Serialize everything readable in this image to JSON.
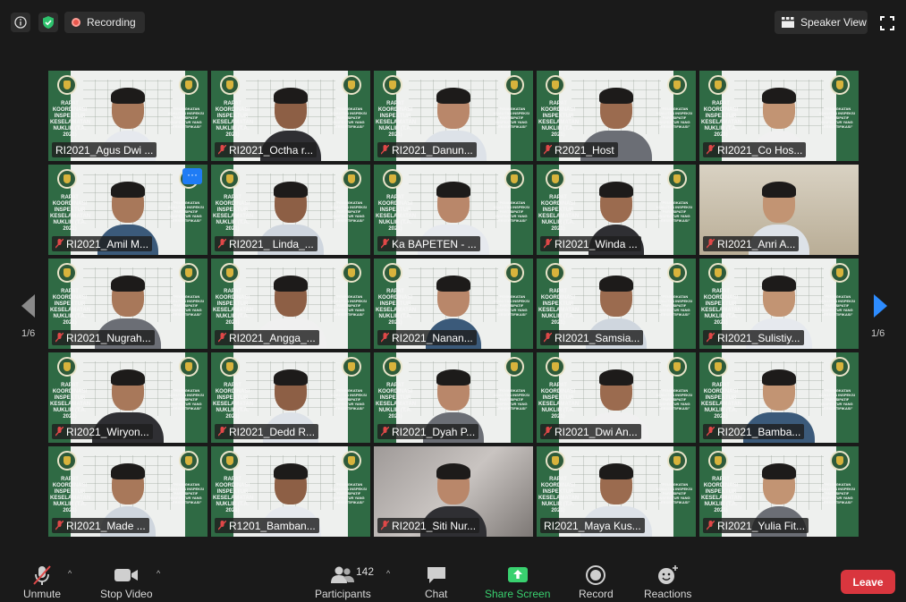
{
  "topbar": {
    "recording_label": "Recording",
    "view_label": "Speaker View",
    "icons": [
      "info-icon",
      "shield-icon",
      "recording-icon",
      "speaker-view-icon",
      "fullscreen-icon"
    ],
    "shield_color": "#2ec26d"
  },
  "pagination": {
    "left_page": "1/6",
    "right_page": "1/6",
    "arrow_right_color": "#2d8cff"
  },
  "slide": {
    "left_text": "RAPAT KOORDINASI INSPEKTUR KESELAMATAN NUKLIR (T.A. 2021)",
    "right_text": "\"PENINGKATAN KUALITAS INSPEKSI PARTISIPATIF INSPEKTUR YANG TERSERTIFIKASI\""
  },
  "participants": [
    {
      "name": "RI2021_Agus Dwi ...",
      "active": true,
      "muted": false
    },
    {
      "name": "RI2021_Octha r...",
      "muted": true
    },
    {
      "name": "RI2021_Danun...",
      "muted": true
    },
    {
      "name": "R2021_Host",
      "muted": true
    },
    {
      "name": "RI2021_Co Hos...",
      "muted": true
    },
    {
      "name": "RI2021_Amil M...",
      "muted": true,
      "menu": "···"
    },
    {
      "name": "RI2021_ Linda_...",
      "muted": true
    },
    {
      "name": "Ka BAPETEN - ...",
      "muted": true
    },
    {
      "name": "RI2021_Winda ...",
      "muted": true
    },
    {
      "name": "RI2021_Anri A...",
      "muted": true
    },
    {
      "name": "RI2021_Nugrah...",
      "muted": true
    },
    {
      "name": "RI2021_Angga_...",
      "muted": true
    },
    {
      "name": "RI2021_Nanan...",
      "muted": true
    },
    {
      "name": "RI2021_Samsia...",
      "muted": true
    },
    {
      "name": "RI2021_Sulistiy...",
      "muted": true
    },
    {
      "name": "RI2021_Wiryon...",
      "muted": true
    },
    {
      "name": "RI2021_Dedd R...",
      "muted": true
    },
    {
      "name": "RI2021_Dyah P...",
      "muted": true
    },
    {
      "name": "RI2021_Dwi An...",
      "muted": true
    },
    {
      "name": "RI2021_Bamba...",
      "muted": true
    },
    {
      "name": "RI2021_Made ...",
      "muted": true
    },
    {
      "name": "R1201_Bamban...",
      "muted": true
    },
    {
      "name": "RI2021_Siti Nur...",
      "muted": true
    },
    {
      "name": "RI2021_Maya Kus...",
      "muted": false
    },
    {
      "name": "RI2021_Yulia Fit...",
      "muted": true
    }
  ],
  "toolbar": {
    "unmute": "Unmute",
    "stop_video": "Stop Video",
    "participants": "Participants",
    "participants_count": "142",
    "chat": "Chat",
    "share_screen": "Share Screen",
    "record": "Record",
    "reactions": "Reactions",
    "leave": "Leave",
    "leave_color": "#d9363e",
    "share_color": "#39d16f"
  }
}
